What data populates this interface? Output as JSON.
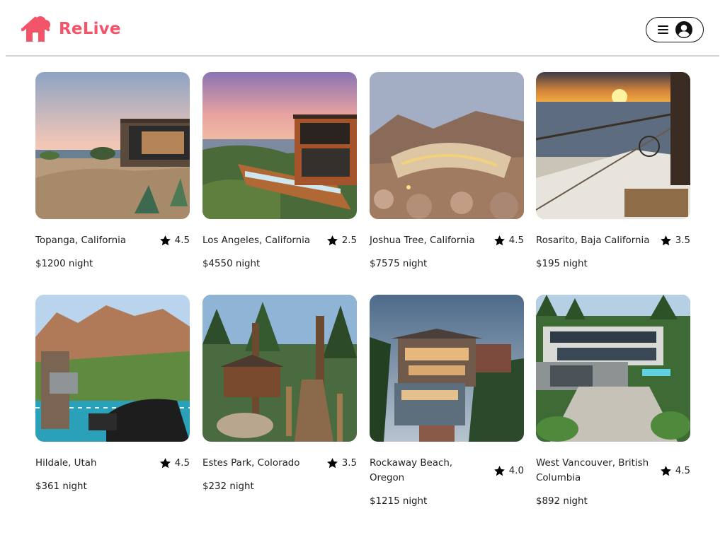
{
  "app": {
    "brand": "ReLive",
    "brand_color": "#f2556a"
  },
  "header": {
    "menu_icons": [
      "hamburger-icon",
      "user-avatar-icon"
    ]
  },
  "listings": [
    {
      "location": "Topanga, California",
      "rating": "4.5",
      "price": "$1200 night",
      "photo": "modern glass house on desert hilltop at dusk"
    },
    {
      "location": "Los Angeles, California",
      "rating": "2.5",
      "price": "$4550 night",
      "photo": "cantilevered hillside house with infinity pool at sunset"
    },
    {
      "location": "Joshua Tree, California",
      "rating": "4.5",
      "price": "$7575 night",
      "photo": "organic curved house among desert boulders"
    },
    {
      "location": "Rosarito, Baja California",
      "rating": "3.5",
      "price": "$195 night",
      "photo": "ocean view balcony at sunset"
    },
    {
      "location": "Hildale, Utah",
      "rating": "4.5",
      "price": "$361 night",
      "photo": "patio with grill facing red canyon cliffs"
    },
    {
      "location": "Estes Park, Colorado",
      "rating": "3.5",
      "price": "$232 night",
      "photo": "wooden cabin in pine forest with boardwalk"
    },
    {
      "location": "Rockaway Beach, Oregon",
      "rating": "4.0",
      "price": "$1215 night",
      "photo": "multi-level coastal house among trees at dusk"
    },
    {
      "location": "West Vancouver, British Columbia",
      "rating": "4.5",
      "price": "$892 night",
      "photo": "large modern mansion with pool surrounded by forest"
    }
  ]
}
